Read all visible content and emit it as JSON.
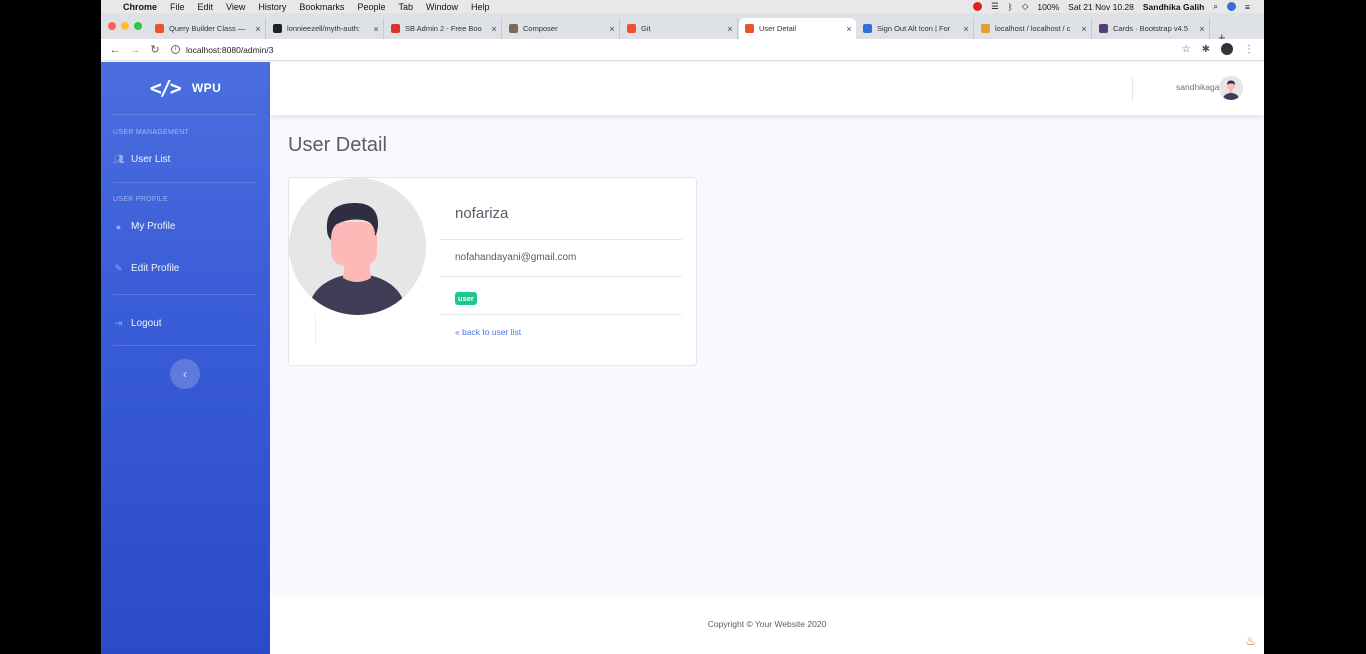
{
  "menubar": {
    "app": "Chrome",
    "items": [
      "File",
      "Edit",
      "View",
      "History",
      "Bookmarks",
      "People",
      "Tab",
      "Window",
      "Help"
    ],
    "battery": "100%",
    "datetime": "Sat 21 Nov 10.28",
    "user": "Sandhika Galih"
  },
  "tabs": [
    {
      "label": "Query Builder Class —",
      "color": "#e8542c"
    },
    {
      "label": "lonnieezell/myth-auth:",
      "color": "#222222"
    },
    {
      "label": "SB Admin 2 - Free Boo",
      "color": "#d9352b"
    },
    {
      "label": "Composer",
      "color": "#7a6a55"
    },
    {
      "label": "Git",
      "color": "#f05033"
    },
    {
      "label": "User Detail",
      "color": "#e8542c"
    },
    {
      "label": "Sign Out Alt Icon | For",
      "color": "#2f6fd6"
    },
    {
      "label": "localhost / localhost / c",
      "color": "#e0a030"
    },
    {
      "label": "Cards · Bootstrap v4.5",
      "color": "#563d7c"
    }
  ],
  "address": {
    "url": "localhost:8080/admin/3"
  },
  "brand": {
    "icon": "</>",
    "name": "WPU"
  },
  "sidebar": {
    "heading_management": "USER MANAGEMENT",
    "user_list": "User List",
    "heading_profile": "USER PROFILE",
    "my_profile": "My Profile",
    "edit_profile": "Edit Profile",
    "logout": "Logout",
    "toggle": "‹"
  },
  "topbar": {
    "username": "sandhikagalih"
  },
  "main": {
    "title": "User Detail",
    "user": {
      "name": "nofariza",
      "email": "nofahandayani@gmail.com",
      "role": "user",
      "back_link": "« back to user list"
    }
  },
  "footer": {
    "copyright": "Copyright © Your Website 2020"
  }
}
